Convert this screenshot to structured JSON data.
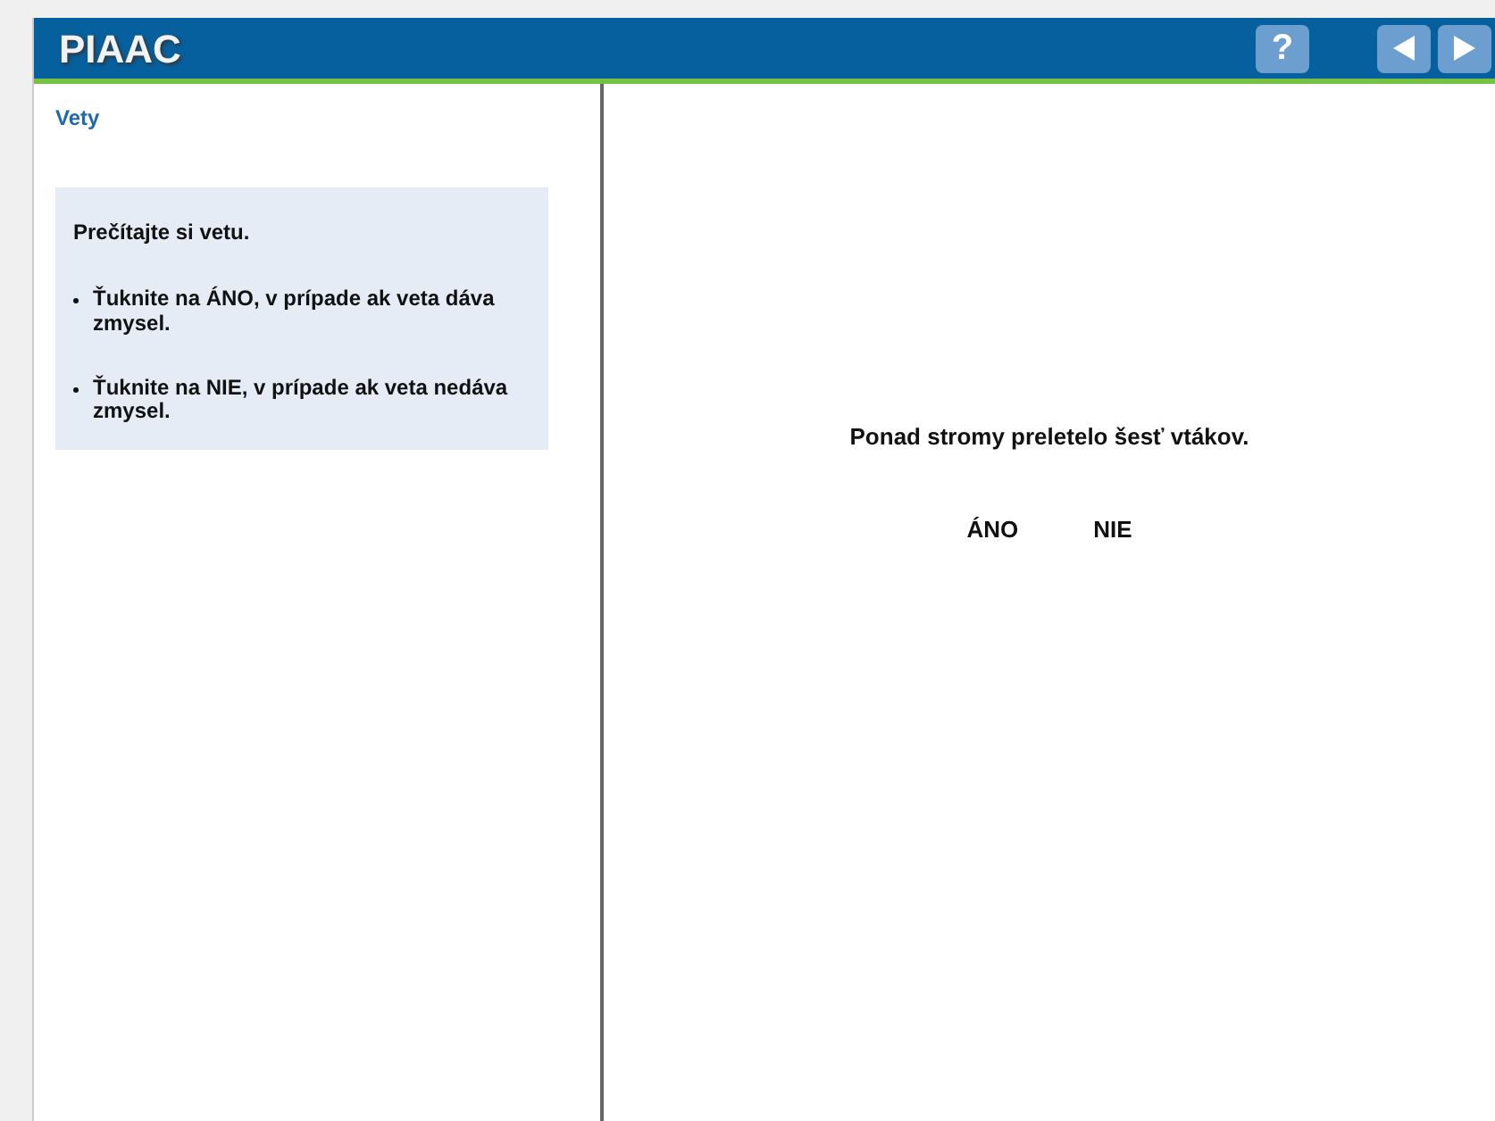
{
  "header": {
    "title": "PIAAC",
    "buttons": [
      {
        "kind": "help",
        "label": "?"
      },
      {
        "kind": "back"
      },
      {
        "kind": "next"
      }
    ]
  },
  "left_panel": {
    "heading": "Vety",
    "instructions": {
      "intro": "Prečítajte si vetu.",
      "bullets": [
        "Ťuknite na ÁNO, v prípade ak veta dáva zmysel.",
        "Ťuknite na NIE, v prípade ak veta nedáva zmysel."
      ]
    }
  },
  "main": {
    "sentence": "Ponad stromy preletelo šesť vtákov.",
    "answers": [
      {
        "label": "ÁNO",
        "selected": false
      },
      {
        "label": "NIE",
        "selected": false
      }
    ]
  }
}
